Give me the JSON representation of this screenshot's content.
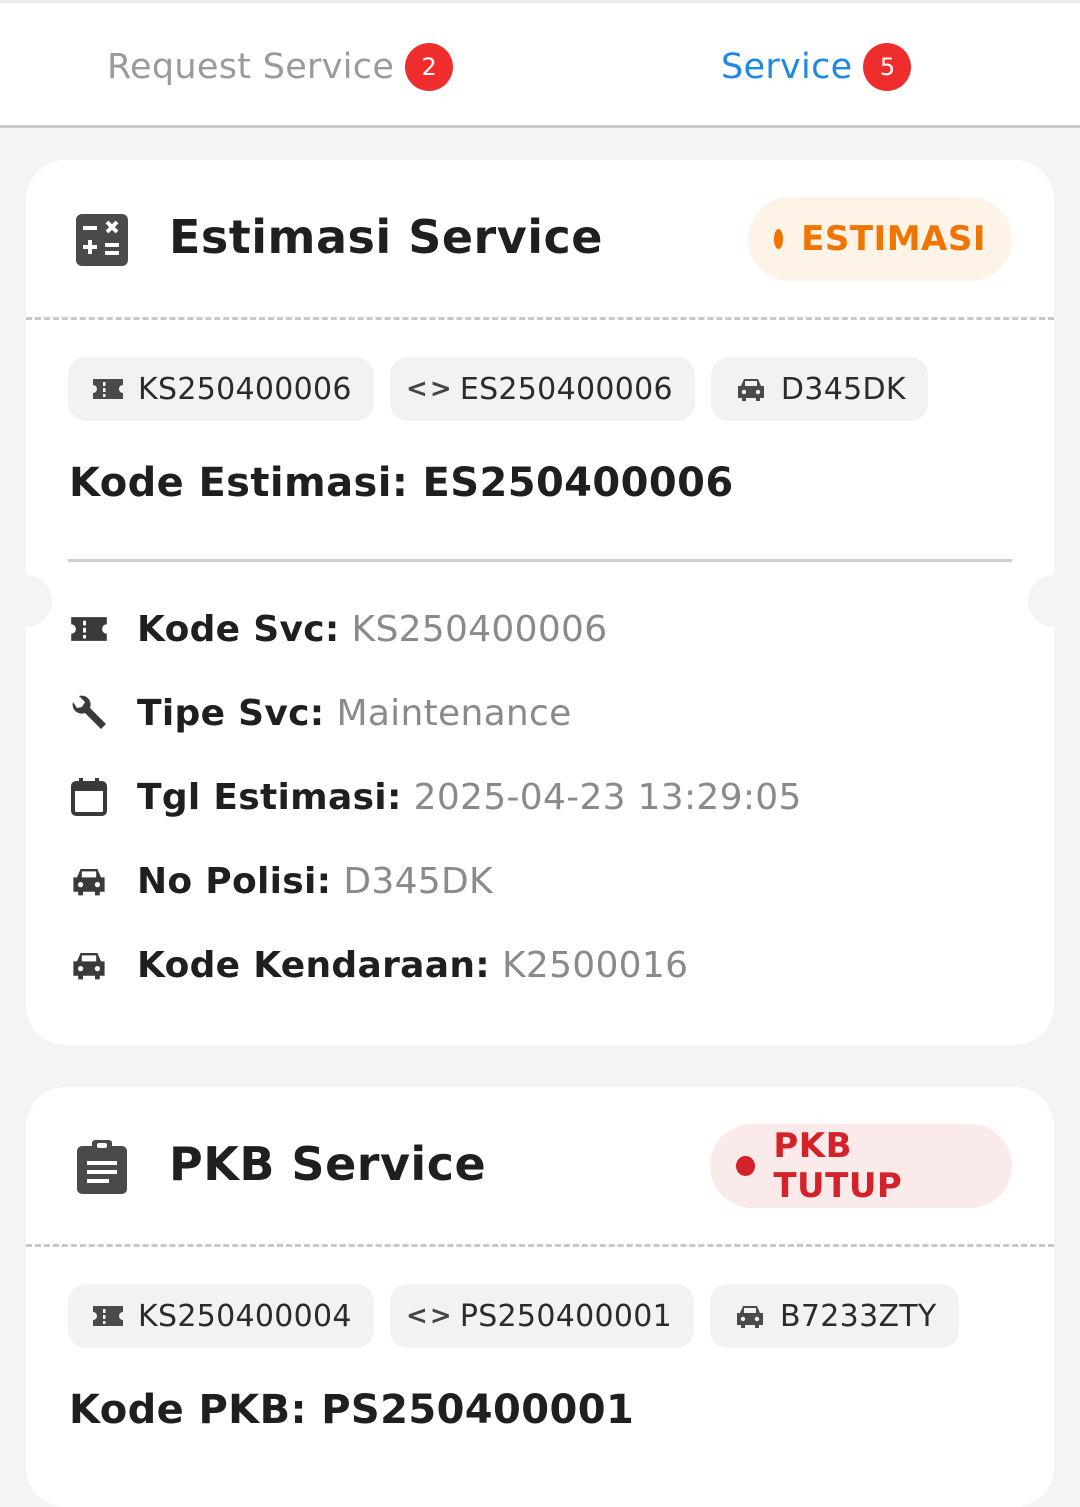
{
  "tabs": [
    {
      "label": "Request Service",
      "badge": "2",
      "active": false
    },
    {
      "label": "Service",
      "badge": "5",
      "active": true
    }
  ],
  "colors": {
    "active_tab": "#1e88e5",
    "badge": "#f02d2d",
    "estimasi_status": "#ef7500",
    "pkb_status": "#d3222a"
  },
  "cards": [
    {
      "icon": "calculator-icon",
      "title": "Estimasi Service",
      "status": "ESTIMASI",
      "chips": [
        {
          "icon": "ticket-icon",
          "text": "KS250400006"
        },
        {
          "icon": "code-icon",
          "text": "ES250400006"
        },
        {
          "icon": "car-icon",
          "text": "D345DK"
        }
      ],
      "code_label": "Kode Estimasi:",
      "code_value": "ES250400006",
      "rows": [
        {
          "icon": "ticket-icon",
          "label": "Kode Svc:",
          "value": "KS250400006"
        },
        {
          "icon": "wrench-icon",
          "label": "Tipe Svc:",
          "value": "Maintenance"
        },
        {
          "icon": "calendar-icon",
          "label": "Tgl Estimasi:",
          "value": "2025-04-23 13:29:05"
        },
        {
          "icon": "car-icon",
          "label": "No Polisi:",
          "value": "D345DK"
        },
        {
          "icon": "car-icon",
          "label": "Kode Kendaraan:",
          "value": "K2500016"
        }
      ]
    },
    {
      "icon": "clipboard-icon",
      "title": "PKB Service",
      "status": "PKB TUTUP",
      "chips": [
        {
          "icon": "ticket-icon",
          "text": "KS250400004"
        },
        {
          "icon": "code-icon",
          "text": "PS250400001"
        },
        {
          "icon": "car-icon",
          "text": "B7233ZTY"
        }
      ],
      "code_label": "Kode PKB:",
      "code_value": "PS250400001"
    }
  ]
}
